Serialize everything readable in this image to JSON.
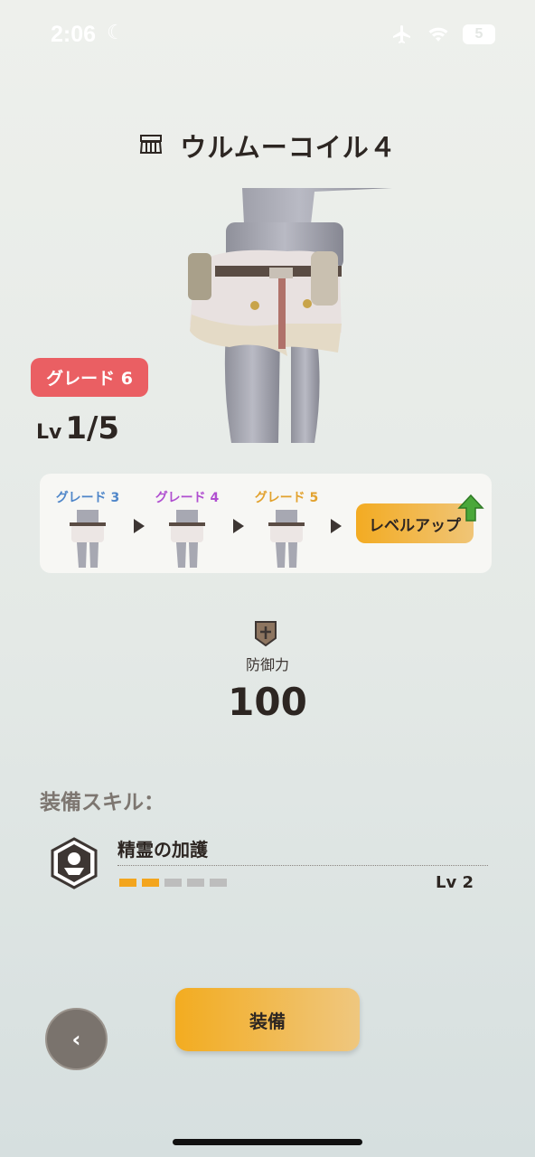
{
  "status_bar": {
    "time": "2:06",
    "moon_icon": "moon-icon",
    "airplane_icon": "airplane-icon",
    "wifi_icon": "wifi-icon",
    "battery_level": "5"
  },
  "header": {
    "icon": "waist-armor-icon",
    "title": "ウルムーコイル４"
  },
  "equipment": {
    "grade_label": "グレード 6",
    "grade_color": "#ea5f63",
    "level_prefix": "Lv",
    "level_value": "1/5"
  },
  "upgrade_panel": {
    "stages": [
      {
        "label": "グレード 3",
        "color": "#4f86c9"
      },
      {
        "label": "グレード 4",
        "color": "#b04fd0"
      },
      {
        "label": "グレード 5",
        "color": "#e2a22e"
      }
    ],
    "level_up_label": "レベルアップ",
    "level_up_icon": "up-arrow-icon"
  },
  "stats": {
    "defense_icon": "shield-icon",
    "defense_label": "防御力",
    "defense_value": "100"
  },
  "skills": {
    "heading": "装備スキル：",
    "items": [
      {
        "icon": "skill-emblem-icon",
        "name": "精霊の加護",
        "level_label": "Lv 2",
        "level": 2,
        "max_level": 5
      }
    ]
  },
  "actions": {
    "equip_label": "装備",
    "back_label": "‹"
  },
  "colors": {
    "accent": "#f3ab22",
    "skill_filled": "#f3a51e",
    "skill_empty": "#bdbdbd"
  }
}
